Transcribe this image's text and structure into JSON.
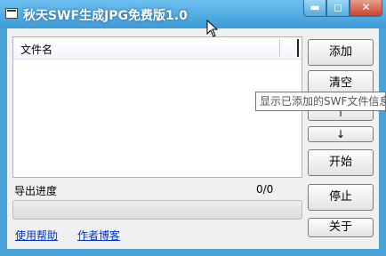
{
  "window": {
    "title": "秋天SWF生成JPG免费版1.0"
  },
  "titlebar": {
    "minimize_glyph": "▬",
    "maximize_glyph": "◻",
    "close_glyph": "✕"
  },
  "list": {
    "column_header": "文件名",
    "items": []
  },
  "buttons": {
    "add": "添加",
    "clear": "清空",
    "up": "↑",
    "down": "↓",
    "start": "开始",
    "stop": "停止",
    "about": "关于"
  },
  "progress": {
    "label": "导出进度",
    "count_text": "0/0",
    "value": 0
  },
  "links": {
    "help": "使用帮助",
    "blog": "作者博客"
  },
  "tooltip": {
    "text": "显示已添加的SWF文件信息"
  },
  "colors": {
    "titlebar": "#4aa3d8",
    "link": "#0033cc",
    "progress_fill": "#3cb043"
  }
}
